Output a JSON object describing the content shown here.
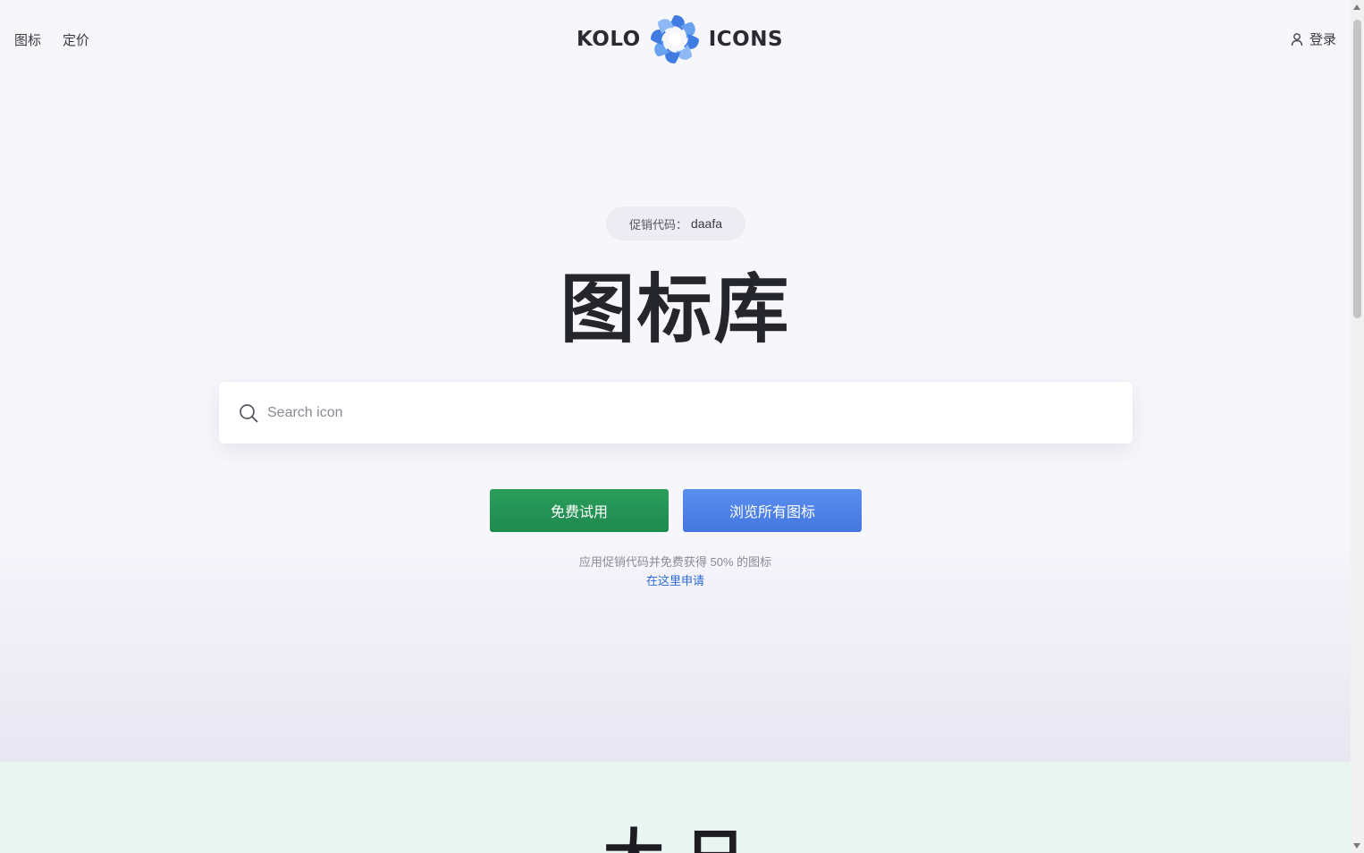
{
  "nav": {
    "links": [
      "图标",
      "定价"
    ],
    "logo_left": "KOLO",
    "logo_right": "ICONS",
    "login_label": "登录"
  },
  "promo": {
    "label": "促销代码：",
    "code": "daafa"
  },
  "hero": {
    "title": "图标库"
  },
  "search": {
    "placeholder": "Search icon",
    "value": ""
  },
  "actions": {
    "free_trial": "免费试用",
    "browse_all": "浏览所有图标"
  },
  "hint": {
    "text": "应用促销代码并免费获得 50% 的图标",
    "apply_link": "在这里申请"
  },
  "next_section": {
    "heading_partial": "大 日"
  },
  "colors": {
    "free_button": "#1e8a4d",
    "browse_button": "#4577e0",
    "link": "#2a6ad8",
    "logo_blue": "#3f7be0"
  },
  "icons": {
    "logo": "swirl-logo-icon",
    "login": "user-icon",
    "search": "search-icon"
  }
}
